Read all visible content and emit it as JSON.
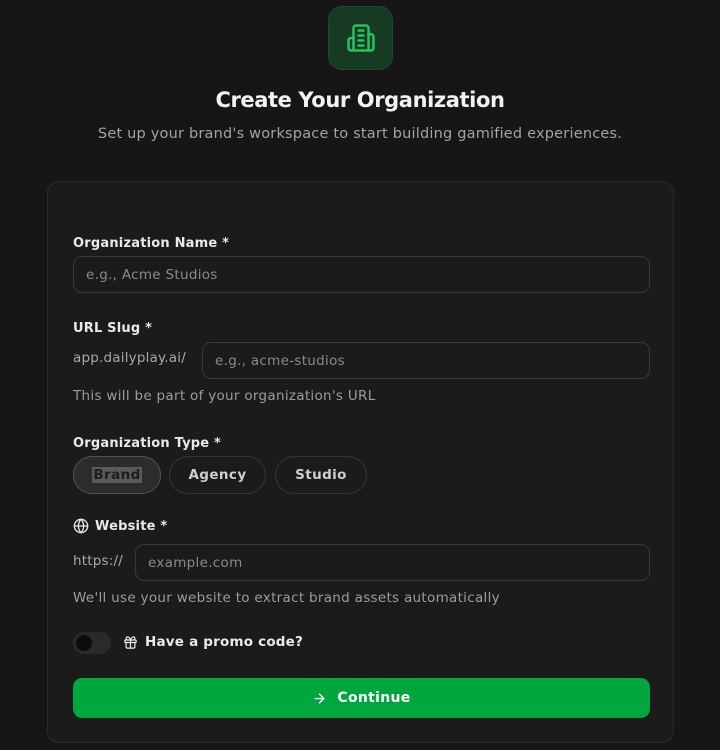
{
  "header": {
    "logo_icon": "building-icon",
    "accent_color": "#22c55e",
    "title": "Create Your Organization",
    "subtitle": "Set up your brand's workspace to start building gamified experiences."
  },
  "form": {
    "org_name": {
      "label": "Organization Name *",
      "value": "",
      "placeholder": "e.g., Acme Studios"
    },
    "url_slug": {
      "label": "URL Slug *",
      "prefix": "app.dailyplay.ai/",
      "value": "",
      "placeholder": "e.g., acme-studios",
      "hint": "This will be part of your organization's URL"
    },
    "org_type": {
      "label": "Organization Type *",
      "options": [
        "Brand",
        "Agency",
        "Studio"
      ],
      "selected": "Brand"
    },
    "website": {
      "icon": "globe-icon",
      "label": "Website *",
      "prefix": "https://",
      "value": "",
      "placeholder": "example.com",
      "hint": "We'll use your website to extract brand assets automatically"
    },
    "promo": {
      "icon": "gift-icon",
      "label": "Have a promo code?",
      "enabled": false
    },
    "continue": {
      "icon": "arrow-right-icon",
      "label": "Continue",
      "color": "#00a63e"
    }
  }
}
